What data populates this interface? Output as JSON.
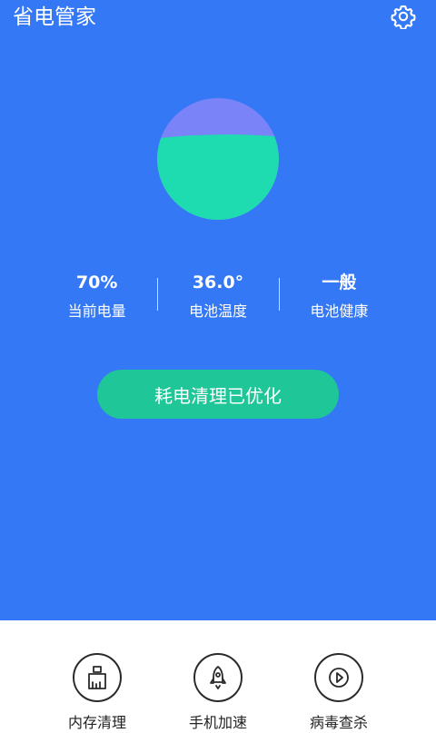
{
  "header": {
    "title": "省电管家",
    "settings_icon": "gear-icon"
  },
  "battery": {
    "level": 0.7,
    "colors": {
      "fill": "#1edcb0",
      "empty": "#7b83f8"
    }
  },
  "stats": [
    {
      "value": "70%",
      "label": "当前电量"
    },
    {
      "value": "36.0°",
      "label": "电池温度"
    },
    {
      "value": "一般",
      "label": "电池健康"
    }
  ],
  "optimize_button": {
    "label": "耗电清理已优化"
  },
  "tools": [
    {
      "label": "内存清理",
      "icon": "broom-icon"
    },
    {
      "label": "手机加速",
      "icon": "rocket-icon"
    },
    {
      "label": "病毒查杀",
      "icon": "shield-scan-icon"
    }
  ],
  "colors": {
    "primary_bg": "#3478f6",
    "accent": "#1fc698"
  }
}
